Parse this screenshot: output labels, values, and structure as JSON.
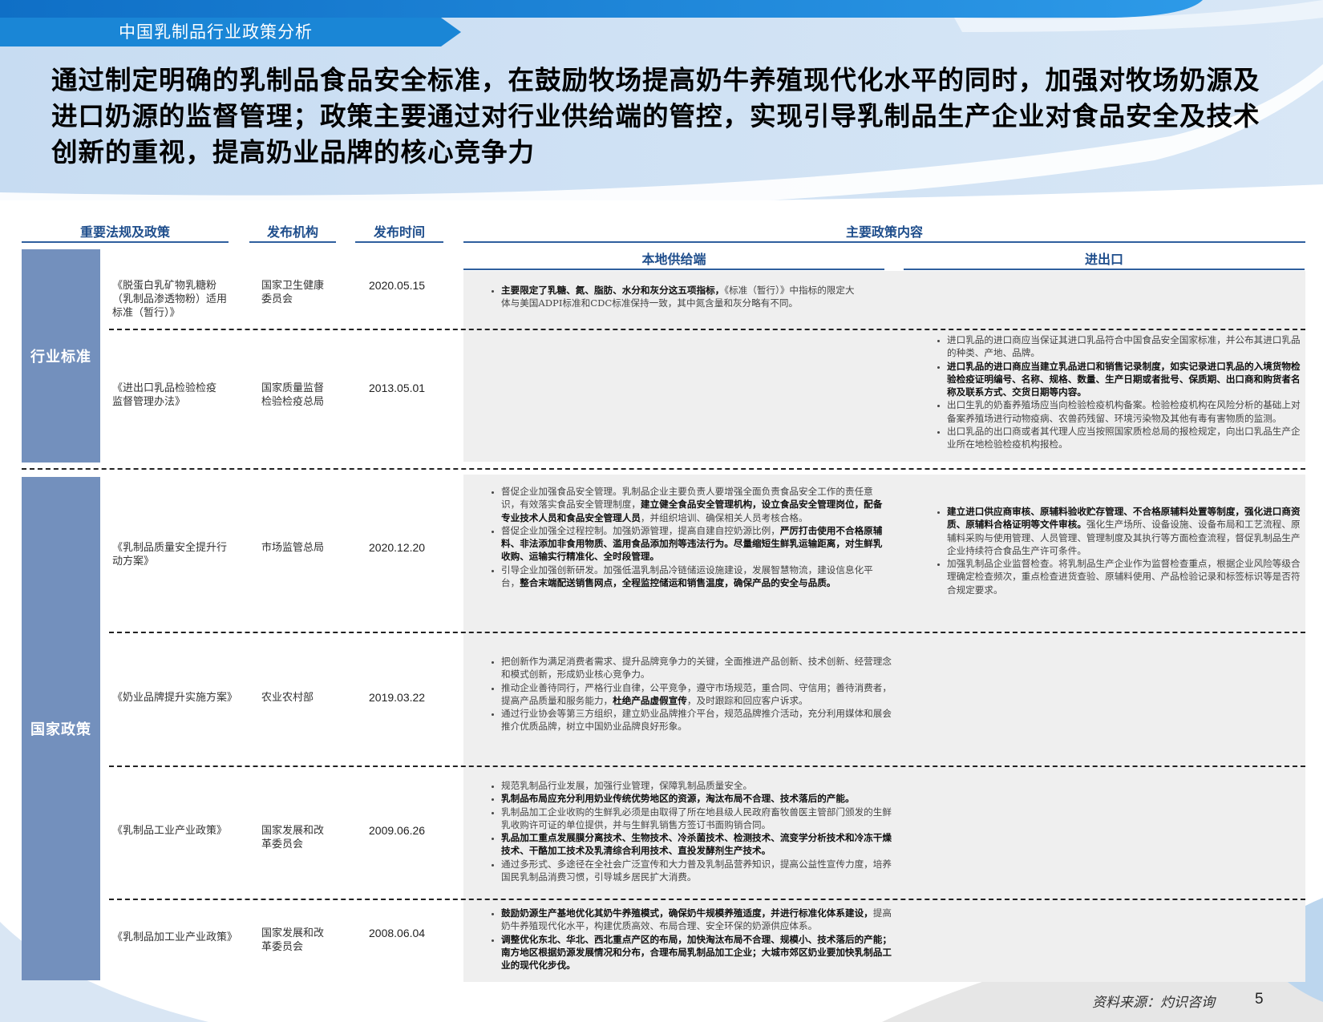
{
  "header": {
    "section_title": "中国乳制品行业政策分析",
    "headline": "通过制定明确的乳制品食品安全标准，在鼓励牧场提高奶牛养殖现代化水平的同时，加强对牧场奶源及进口奶源的监督管理；政策主要通过对行业供给端的管控，实现引导乳制品生产企业对食品安全及技术创新的重视，提高奶业品牌的核心竞争力"
  },
  "table": {
    "col_policy": "重要法规及政策",
    "col_org": "发布机构",
    "col_date": "发布时间",
    "col_content": "主要政策内容",
    "sub_local": "本地供给端",
    "sub_import": "进出口",
    "groups": [
      "行业标准",
      "国家政策"
    ],
    "rows": [
      {
        "name": "《脱蛋白乳矿物乳糖粉（乳制品渗透物粉）适用标准（暂行）》",
        "org": "国家卫生健康委员会",
        "date": "2020.05.15",
        "local": [
          {
            "bold": "主要限定了乳糖、氮、脂肪、水分和灰分这五项指标，",
            "text": "《标准（暂行）》中指标的限定大体与美国ADPI标准和CDC标准保持一致，其中氮含量和灰分略有不同。"
          }
        ],
        "import": []
      },
      {
        "name": "《进出口乳品检验检疫监督管理办法》",
        "org": "国家质量监督检验检疫总局",
        "date": "2013.05.01",
        "local": [],
        "import": [
          {
            "text": "进口乳品的进口商应当保证其进口乳品符合中国食品安全国家标准，并公布其进口乳品的种类、产地、品牌。"
          },
          {
            "bold": "进口乳品的进口商应当建立乳品进口和销售记录制度，如实记录进口乳品的入境货物检验检疫证明编号、名称、规格、数量、生产日期或者批号、保质期、出口商和购货者名称及联系方式、交货日期等内容。"
          },
          {
            "text": "出口生乳的奶畜养殖场应当向检验检疫机构备案。检验检疫机构在风险分析的基础上对备案养殖场进行动物疫病、农兽药残留、环境污染物及其他有毒有害物质的监测。"
          },
          {
            "text": "出口乳品的出口商或者其代理人应当按照国家质检总局的报检规定，向出口乳品生产企业所在地检验检疫机构报检。"
          }
        ]
      },
      {
        "name": "《乳制品质量安全提升行动方案》",
        "org": "市场监管总局",
        "date": "2020.12.20",
        "local": [
          {
            "text": "督促企业加强食品安全管理。乳制品企业主要负责人要增强全面负责食品安全工作的责任意识，有效落实食品安全管理制度，",
            "bold": "建立健全食品安全管理机构，设立食品安全管理岗位，配备专业技术人员和食品安全管理人员",
            "text2": "，并组织培训、确保相关人员考核合格。"
          },
          {
            "text": "督促企业加强全过程控制。加强奶源管理，提高自建自控奶源比例，",
            "bold": "严厉打击使用不合格原辅料、非法添加非食用物质、滥用食品添加剂等违法行为。尽量缩短生鲜乳运输距离，对生鲜乳收购、运输实行精准化、全时段管理。"
          },
          {
            "text": "引导企业加强创新研发。加强低温乳制品冷链储运设施建设，发展智慧物流，建设信息化平台，",
            "bold": "整合末端配送销售网点，全程监控储运和销售温度，确保产品的安全与品质。"
          }
        ],
        "import": [
          {
            "bold": "建立进口供应商审核、原辅料验收贮存管理、不合格原辅料处置等制度，强化进口商资质、原辅料合格证明等文件审核。",
            "text": "强化生产场所、设备设施、设备布局和工艺流程、原辅料采购与使用管理、人员管理、管理制度及其执行等方面检查流程，督促乳制品生产企业持续符合食品生产许可条件。"
          },
          {
            "text": "加强乳制品企业监督检查。将乳制品生产企业作为监督检查重点，根据企业风险等级合理确定检查频次，重点检查进货查验、原辅料使用、产品检验记录和标签标识等是否符合规定要求。"
          }
        ]
      },
      {
        "name": "《奶业品牌提升实施方案》",
        "org": "农业农村部",
        "date": "2019.03.22",
        "local": [
          {
            "text": "把创新作为满足消费者需求、提升品牌竞争力的关键，全面推进产品创新、技术创新、经营理念和模式创新，形成奶业核心竞争力。"
          },
          {
            "text": "推动企业善待同行，严格行业自律，公平竞争，遵守市场规范，重合同、守信用；善待消费者，提高产品质量和服务能力，",
            "bold": "杜绝产品虚假宣传",
            "text2": "，及时跟踪和回应客户诉求。"
          },
          {
            "text": "通过行业协会等第三方组织，建立奶业品牌推介平台，规范品牌推介活动，充分利用媒体和展会推介优质品牌，树立中国奶业品牌良好形象。"
          }
        ],
        "import": []
      },
      {
        "name": "《乳制品工业产业政策》",
        "org": "国家发展和改革委员会",
        "date": "2009.06.26",
        "local": [
          {
            "text": "规范乳制品行业发展，加强行业管理，保障乳制品质量安全。"
          },
          {
            "bold": "乳制品布局应充分利用奶业传统优势地区的资源，淘汰布局不合理、技术落后的产能。"
          },
          {
            "text": "乳制品加工企业收购的生鲜乳必须是由取得了所在地县级人民政府畜牧兽医主管部门颁发的生鲜乳收购许可证的单位提供，并与生鲜乳销售方签订书面购销合同。"
          },
          {
            "bold": "乳品加工重点发展膜分离技术、生物技术、冷杀菌技术、检测技术、流变学分析技术和冷冻干燥技术、干酪加工技术及乳清综合利用技术、直投发酵剂生产技术。"
          },
          {
            "text": "通过多形式、多途径在全社会广泛宣传和大力普及乳制品营养知识，提高公益性宣传力度，培养国民乳制品消费习惯，引导城乡居民扩大消费。"
          }
        ],
        "import": []
      },
      {
        "name": "《乳制品加工业产业政策》",
        "org": "国家发展和改革委员会",
        "date": "2008.06.04",
        "local": [
          {
            "bold": "鼓励奶源生产基地优化其奶牛养殖模式，确保奶牛规模养殖适度，并进行标准化体系建设，",
            "text": "提高奶牛养殖现代化水平，构建优质高效、布局合理、安全环保的奶源供应体系。"
          },
          {
            "bold": "调整优化东北、华北、西北重点产区的布局，加快淘汰布局不合理、规模小、技术落后的产能；南方地区根据奶源发展情况和分布，合理布局乳制品加工企业；大城市郊区奶业要加快乳制品工业的现代化步伐。"
          }
        ],
        "import": []
      }
    ]
  },
  "footer": {
    "source": "资料来源：灼识咨询",
    "page_number": "5"
  },
  "colors": {
    "accent_blue": "#1a86d6",
    "group_bar": "#7390bd",
    "header_text": "#1f4e8c",
    "content_bg": "#efefef"
  }
}
